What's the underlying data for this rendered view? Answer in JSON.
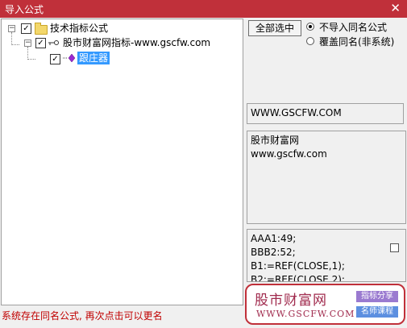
{
  "window": {
    "title": "导入公式",
    "close_icon": "✕"
  },
  "tree": {
    "root": {
      "label": "技术指标公式",
      "expander": "−",
      "checked": true,
      "icon": "folder-icon"
    },
    "child": {
      "label": "股市财富网指标-www.gscfw.com",
      "expander": "−",
      "checked": true,
      "icon": "key-icon"
    },
    "leaf": {
      "label": "跟庄器",
      "checked": true,
      "icon": "formula-icon",
      "selected": true
    }
  },
  "options": {
    "select_all_label": "全部选中",
    "radio_no_import_label": "不导入同名公式",
    "radio_overwrite_label": "覆盖同名(非系统)",
    "selected_radio": "no_import"
  },
  "info": {
    "website": "WWW.GSCFW.COM",
    "description": "股市财富网\nwww.gscfw.com",
    "code": "AAA1:49;\nBBB2:52;\nB1:=REF(CLOSE,1);\nB2:=REF(CLOSE,2);"
  },
  "status_message": "系统存在同名公式, 再次点击可以更名",
  "watermark": {
    "brand": "股市财富网",
    "url": "WWW.GSCFW.COM",
    "tag_1": "指标分享",
    "tag_2": "名师课程"
  },
  "colors": {
    "titlebar": "#c0303a",
    "selection": "#3399ff",
    "status_text": "#c00000",
    "watermark_border": "#c0303a"
  }
}
